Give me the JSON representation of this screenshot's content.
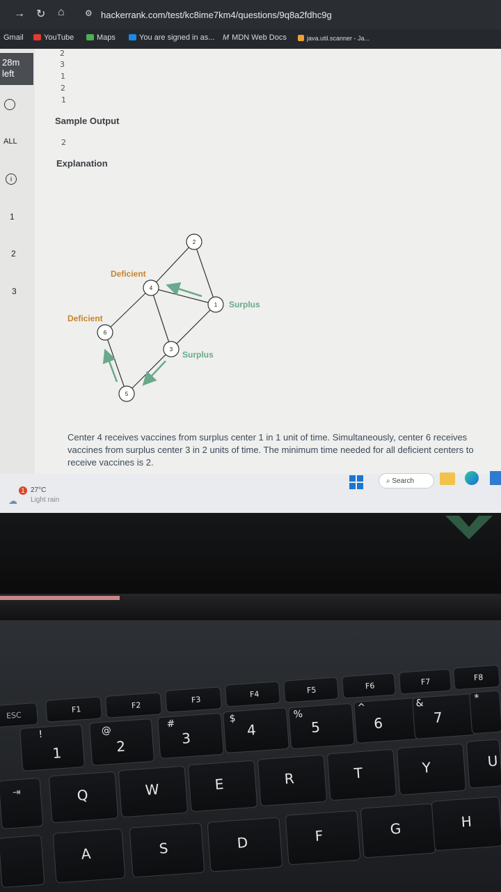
{
  "browser": {
    "url": "hackerrank.com/test/kc8ime7km4/questions/9q8a2fdhc9g",
    "bookmarks": [
      "Gmail",
      "YouTube",
      "Maps",
      "You are signed in as...",
      "MDN Web Docs",
      "java.util.scanner - Ja..."
    ]
  },
  "sidebar": {
    "timer_line1": "28m",
    "timer_line2": "left",
    "all_label": "ALL",
    "question_numbers": [
      "1",
      "2",
      "3"
    ]
  },
  "content": {
    "input_values": [
      "2",
      "3",
      "1",
      "2",
      "1"
    ],
    "sample_output_heading": "Sample Output",
    "sample_output_value": "2",
    "explanation_heading": "Explanation",
    "caption": "Center 4 receives vaccines from surplus center 1 in 1 unit of time. Simultaneously, center 6 receives vaccines from surplus center 3 in 2 units of time. The minimum time needed for all deficient centers to receive vaccines is 2."
  },
  "diagram": {
    "nodes": [
      "2",
      "4",
      "1",
      "6",
      "3",
      "5"
    ],
    "labels": {
      "deficient_4": "Deficient",
      "deficient_6": "Deficient",
      "surplus_1": "Surplus",
      "surplus_3": "Surplus"
    }
  },
  "taskbar": {
    "weather_badge": "1",
    "temperature": "27°C",
    "condition": "Light rain",
    "search_label": "Search"
  },
  "keyboard": {
    "fkeys": [
      "ESC",
      "F1",
      "F2",
      "F3",
      "F4",
      "F5",
      "F6",
      "F7",
      "F8"
    ],
    "number_row": [
      "1",
      "2",
      "3",
      "4",
      "5",
      "6",
      "7"
    ],
    "symbols": [
      "!",
      "@",
      "#",
      "$",
      "%",
      "^",
      "&",
      "*"
    ],
    "letter_row_top": [
      "Q",
      "W",
      "E",
      "R",
      "T",
      "Y",
      "U"
    ],
    "letter_row_mid": [
      "A",
      "S",
      "D",
      "F",
      "G",
      "H"
    ]
  },
  "colors": {
    "accent_green": "#6aa98b",
    "label_orange": "#c8832a",
    "page_bg": "#efefed"
  }
}
